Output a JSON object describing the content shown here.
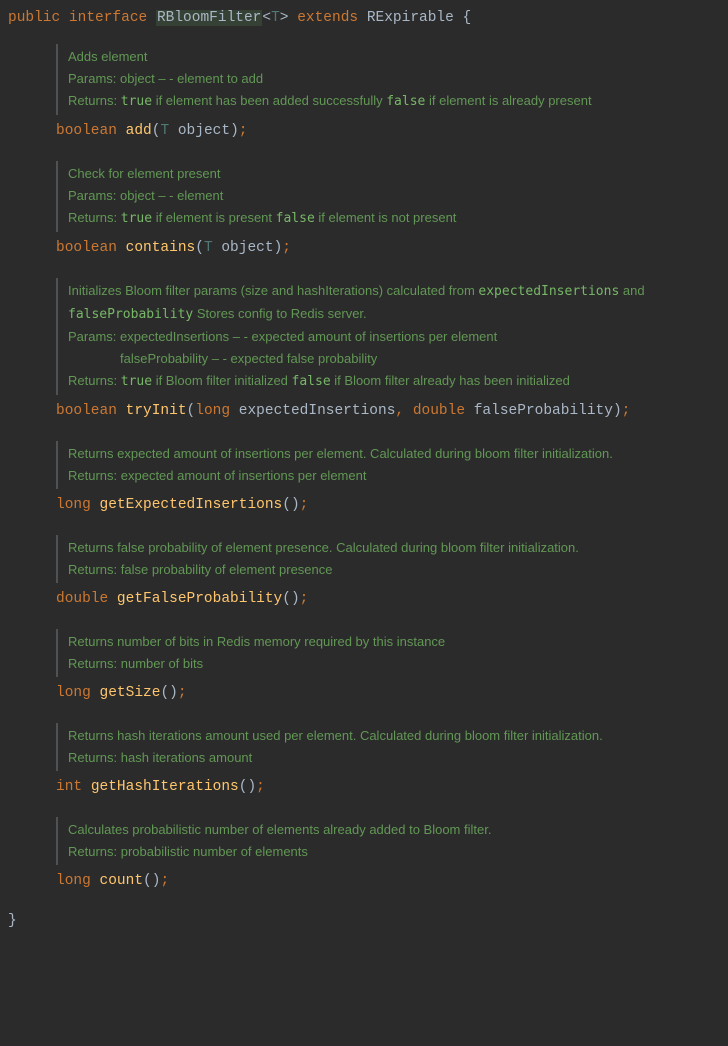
{
  "declaration": {
    "kw_public": "public",
    "kw_interface": "interface",
    "name": "RBloomFilter",
    "generic_open": "<",
    "generic_param": "T",
    "generic_close": ">",
    "kw_extends": "extends",
    "super": "RExpirable",
    "brace_open": " {"
  },
  "methods": [
    {
      "doc": {
        "summary": "Adds element",
        "params_label": "Params:",
        "params_text": " object – - element to add",
        "returns_label": "Returns:",
        "returns_pre": " ",
        "returns_code1": "true",
        "returns_mid": " if element has been added successfully ",
        "returns_code2": "false",
        "returns_post": " if element is already present"
      },
      "ret_type": "boolean",
      "name": "add",
      "params": "(T object);",
      "param_generic": true
    },
    {
      "doc": {
        "summary": "Check for element present",
        "params_label": "Params:",
        "params_text": " object – - element",
        "returns_label": "Returns:",
        "returns_pre": " ",
        "returns_code1": "true",
        "returns_mid": " if element is present ",
        "returns_code2": "false",
        "returns_post": " if element is not present"
      },
      "ret_type": "boolean",
      "name": "contains",
      "params": "(T object);",
      "param_generic": true
    },
    {
      "doc": {
        "summary_pre": "Initializes Bloom filter params (size and hashIterations) calculated from ",
        "summary_code1": "expectedInsertions",
        "summary_mid": " and ",
        "summary_code2": "falseProbability",
        "summary_post": " Stores config to Redis server.",
        "params_label": "Params:",
        "params_text": " expectedInsertions – - expected amount of insertions per element",
        "params_text2": "falseProbability – - expected false probability",
        "returns_label": "Returns:",
        "returns_pre": " ",
        "returns_code1": "true",
        "returns_mid": " if Bloom filter initialized ",
        "returns_code2": "false",
        "returns_post": " if Bloom filter already has been initialized"
      },
      "ret_type": "boolean",
      "name": "tryInit",
      "params_full": "(long expectedInsertions, double falseProbability);"
    },
    {
      "doc": {
        "summary": "Returns expected amount of insertions per element. Calculated during bloom filter initialization.",
        "returns_label": "Returns:",
        "returns_text": " expected amount of insertions per element"
      },
      "ret_type": "long",
      "name": "getExpectedInsertions",
      "params": "();"
    },
    {
      "doc": {
        "summary": "Returns false probability of element presence. Calculated during bloom filter initialization.",
        "returns_label": "Returns:",
        "returns_text": " false probability of element presence"
      },
      "ret_type": "double",
      "name": "getFalseProbability",
      "params": "();"
    },
    {
      "doc": {
        "summary": "Returns number of bits in Redis memory required by this instance",
        "returns_label": "Returns:",
        "returns_text": " number of bits"
      },
      "ret_type": "long",
      "name": "getSize",
      "params": "();"
    },
    {
      "doc": {
        "summary": "Returns hash iterations amount used per element. Calculated during bloom filter initialization.",
        "returns_label": "Returns:",
        "returns_text": " hash iterations amount"
      },
      "ret_type": "int",
      "name": "getHashIterations",
      "params": "();"
    },
    {
      "doc": {
        "summary": "Calculates probabilistic number of elements already added to Bloom filter.",
        "returns_label": "Returns:",
        "returns_text": " probabilistic number of elements"
      },
      "ret_type": "long",
      "name": "count",
      "params": "();"
    }
  ],
  "closing_brace": "}"
}
